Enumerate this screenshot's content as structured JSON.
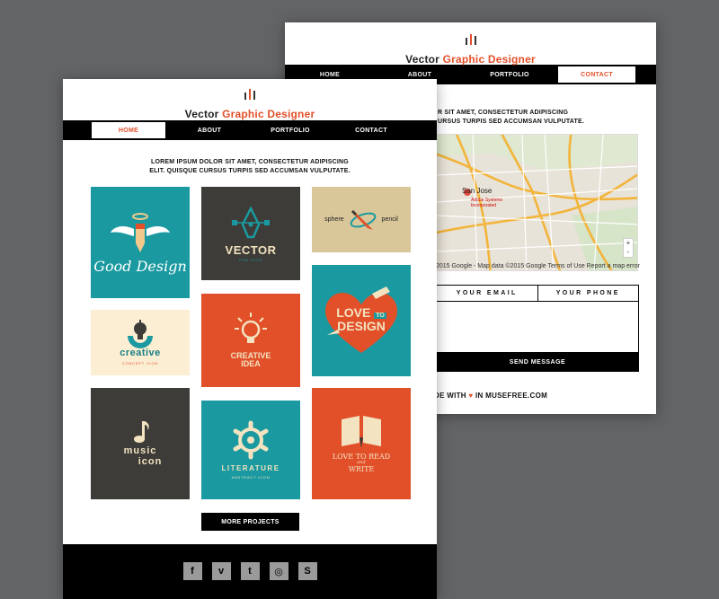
{
  "brand": {
    "name": "Vector",
    "accent": "Graphic Designer",
    "accent_color": "#e2502a"
  },
  "contact_page": {
    "nav": [
      "HOME",
      "ABOUT",
      "PORTFOLIO",
      "CONTACT"
    ],
    "active_nav": "CONTACT",
    "intro_line1": "R SIT AMET, CONSECTETUR ADIPISCING",
    "intro_line2": "URSUS TURPIS SED ACCUMSAN VULPUTATE.",
    "map": {
      "city_label": "San Jose",
      "pin_sub": "Adobe Systems Incorporated",
      "credit": "2015 Google - Map data ©2015 Google   Terms of Use   Report a map error",
      "zoom_in": "+",
      "zoom_out": "-"
    },
    "form": {
      "email_label": "YOUR EMAIL",
      "phone_label": "YOUR PHONE",
      "send_label": "SEND MESSAGE"
    },
    "footer_prefix": "DE WITH",
    "heart": "♥",
    "footer_suffix": "IN MUSEFREE.COM"
  },
  "home_page": {
    "nav": [
      "HOME",
      "ABOUT",
      "PORTFOLIO",
      "CONTACT"
    ],
    "active_nav": "HOME",
    "intro_line1": "LOREM IPSUM DOLOR SIT AMET, CONSECTETUR ADIPISCING",
    "intro_line2": "ELIT. QUISQUE CURSUS TURPIS SED ACCUMSAN VULPUTATE.",
    "tiles": {
      "good_design": {
        "title": "Good Design",
        "color": "#1a9aa0"
      },
      "vector_pen": {
        "title": "VECTOR",
        "sub": "PEN ICON",
        "color": "#3d3c38"
      },
      "sphere_pencil": {
        "left": "sphere",
        "right": "pencil",
        "color": "#d9c79a"
      },
      "creative": {
        "title": "creative",
        "sub": "CONCEPT ICON",
        "color": "#fbeed3"
      },
      "creative_idea": {
        "line1": "CREATIVE",
        "line2": "IDEA",
        "color": "#e2502a"
      },
      "love_design": {
        "line1": "LOVE",
        "to": "TO",
        "line2": "DESIGN",
        "color": "#1a9aa0"
      },
      "music": {
        "line1": "music",
        "line2": "icon",
        "color": "#3d3c38"
      },
      "literature": {
        "title": "LITERATURE",
        "sub": "ABSTRACT ICON",
        "color": "#1a9aa0"
      },
      "love_read": {
        "line1": "LOVE TO READ",
        "and": "and",
        "line2": "WRITE",
        "color": "#e2502a"
      }
    },
    "more_label": "MORE PROJECTS",
    "social_icons": [
      "facebook-icon",
      "vimeo-icon",
      "twitter-icon",
      "dribbble-icon",
      "skype-icon"
    ],
    "social_glyphs": [
      "f",
      "v",
      "t",
      "◎",
      "S"
    ]
  }
}
